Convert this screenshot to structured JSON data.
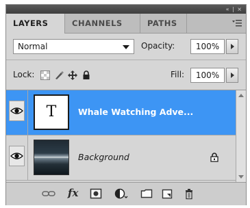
{
  "panel": {
    "titlebar_controls": "« | ×",
    "tabs": [
      {
        "label": "LAYERS",
        "active": true
      },
      {
        "label": "CHANNELS",
        "active": false
      },
      {
        "label": "PATHS",
        "active": false
      }
    ]
  },
  "controls": {
    "blend_mode": "Normal",
    "opacity_label": "Opacity:",
    "opacity_value": "100%",
    "lock_label": "Lock:",
    "fill_label": "Fill:",
    "fill_value": "100%"
  },
  "layers": [
    {
      "name": "Whale Watching  Adve...",
      "type": "text",
      "thumb_glyph": "T",
      "selected": true,
      "visible": true,
      "locked": false
    },
    {
      "name": "Background",
      "type": "image",
      "selected": false,
      "visible": true,
      "locked": true
    }
  ],
  "footer": {
    "fx_label": "fx",
    "icons": [
      "link-icon",
      "fx-icon",
      "layer-mask-icon",
      "adjustment-layer-icon",
      "group-folder-icon",
      "new-layer-icon",
      "trash-icon"
    ]
  },
  "colors": {
    "selection": "#3d95f4",
    "panel_bg": "#d6d6d6",
    "titlebar": "#4a4a4a"
  }
}
